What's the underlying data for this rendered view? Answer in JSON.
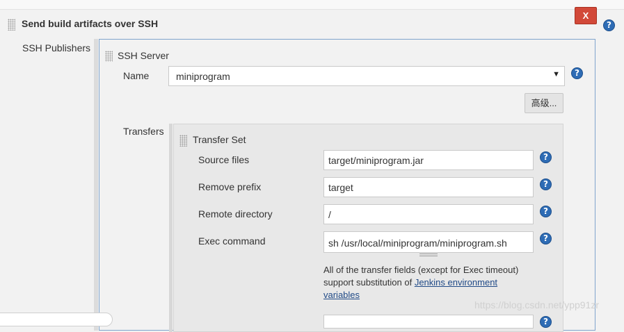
{
  "section": {
    "title": "Send build artifacts over SSH",
    "delete_label": "X",
    "publishers_label": "SSH Publishers"
  },
  "ssh_server": {
    "heading": "SSH Server",
    "name_label": "Name",
    "name_value": "miniprogram",
    "advanced_label": "高级..."
  },
  "transfers": {
    "label": "Transfers",
    "set_heading": "Transfer Set",
    "source_files_label": "Source files",
    "source_files_value": "target/miniprogram.jar",
    "remove_prefix_label": "Remove prefix",
    "remove_prefix_value": "target",
    "remote_directory_label": "Remote directory",
    "remote_directory_value": "/",
    "exec_command_label": "Exec command",
    "exec_command_value": "sh /usr/local/miniprogram/miniprogram.sh",
    "note_text": "All of the transfer fields (except for Exec timeout) support substitution of ",
    "note_link": "Jenkins environment variables"
  },
  "help_glyph": "?",
  "select_arrow": "▼",
  "watermark": "https://blog.csdn.net/ypp91zr",
  "colors": {
    "delete_button": "#d24939",
    "help_icon": "#2e6cb5",
    "panel_border": "#7fa4cc"
  }
}
